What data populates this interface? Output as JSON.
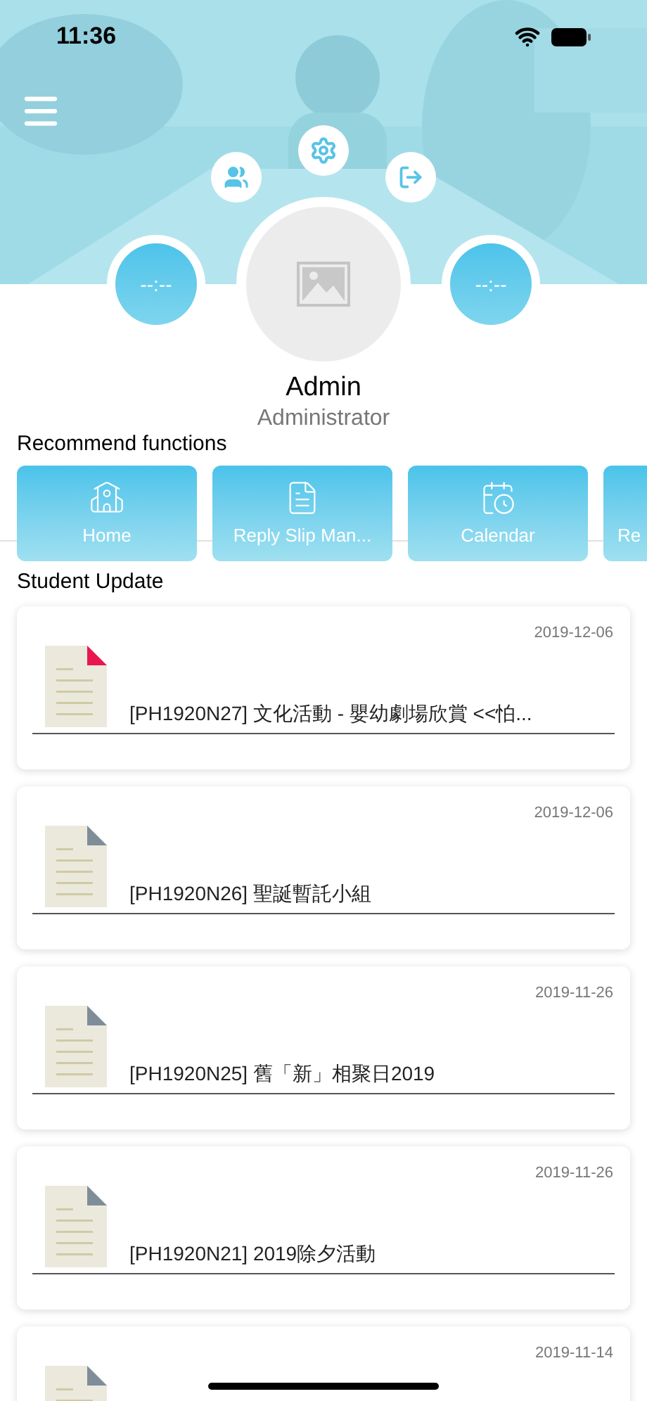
{
  "status_bar": {
    "time": "11:36"
  },
  "profile": {
    "name": "Admin",
    "role": "Administrator",
    "left_counter": "--:--",
    "right_counter": "--:--"
  },
  "recommend": {
    "title": "Recommend functions",
    "tiles": [
      {
        "kind": "school",
        "label": "Home"
      },
      {
        "kind": "slip",
        "label": "Reply Slip Man..."
      },
      {
        "kind": "calendar",
        "label": "Calendar"
      },
      {
        "kind": "none",
        "label": "Re"
      }
    ]
  },
  "updates": {
    "title": "Student Update",
    "items": [
      {
        "date": "2019-12-06",
        "title": "[PH1920N27] 文化活動 - 嬰幼劇場欣賞  <<怕...",
        "color": "#e8174f"
      },
      {
        "date": "2019-12-06",
        "title": "[PH1920N26] 聖誕暫託小組",
        "color": "#7f8d99"
      },
      {
        "date": "2019-11-26",
        "title": "[PH1920N25] 舊「新」相聚日2019",
        "color": "#7f8d99"
      },
      {
        "date": "2019-11-26",
        "title": "[PH1920N21] 2019除夕活動",
        "color": "#7f8d99"
      },
      {
        "date": "2019-11-14",
        "color": "#7f8d99"
      }
    ]
  }
}
